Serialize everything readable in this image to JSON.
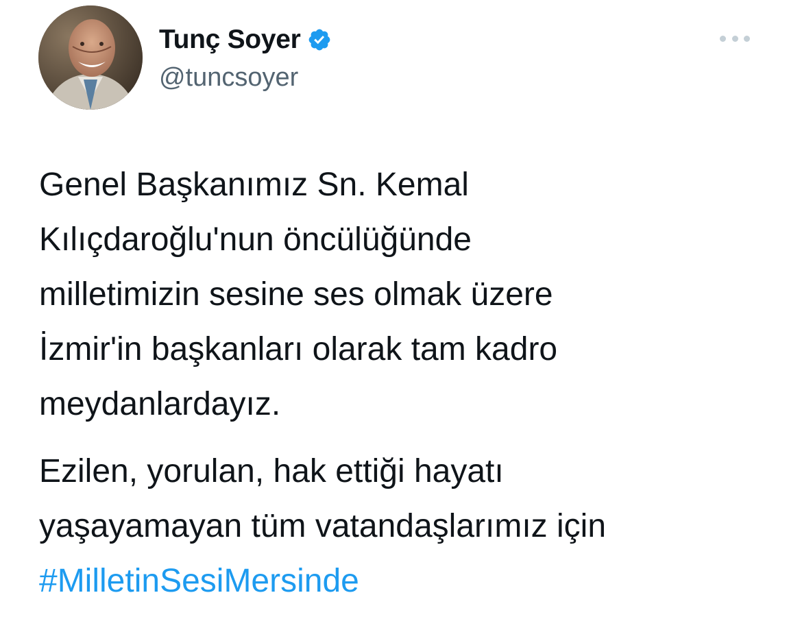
{
  "author": {
    "display_name": "Tunç Soyer",
    "handle": "@tuncsoyer",
    "verified_icon": "verified-badge-icon",
    "verified_color": "#1d9bf0"
  },
  "menu": {
    "icon": "more-options-icon"
  },
  "tweet": {
    "paragraph_1": [
      "Genel Başkanımız Sn. Kemal",
      "Kılıçdaroğlu'nun öncülüğünde",
      "milletimizin sesine ses olmak üzere",
      "İzmir'in başkanları olarak tam kadro",
      "meydanlardayız."
    ],
    "paragraph_2": [
      "Ezilen, yorulan, hak ettiği hayatı",
      "yaşayamayan tüm vatandaşlarımız için"
    ],
    "hashtag": "#MilletinSesiMersinde"
  },
  "colors": {
    "text": "#0f1419",
    "secondary_text": "#536471",
    "link": "#1d9bf0"
  }
}
